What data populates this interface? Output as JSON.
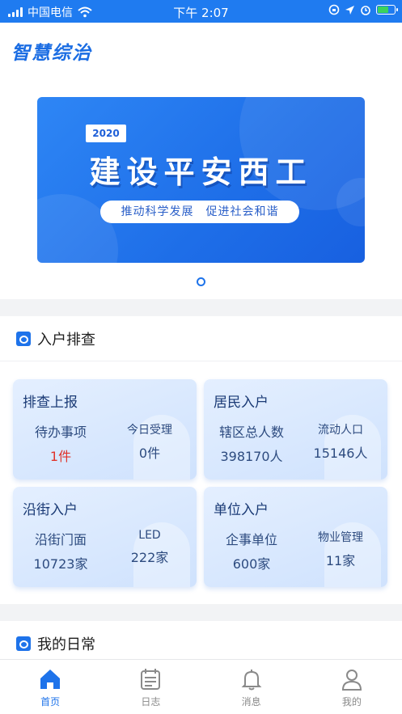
{
  "status_bar": {
    "carrier": "中国电信",
    "time": "下午 2:07"
  },
  "app": {
    "title": "智慧综治"
  },
  "banner": {
    "year": "2020",
    "headline": "建设平安西工",
    "slogan": "推动科学发展　促进社会和谐",
    "page_indicator": {
      "current": 1,
      "total": 1
    }
  },
  "household_section": {
    "title": "入户排查",
    "cards": [
      {
        "title": "排查上报",
        "items": [
          {
            "label": "待办事项",
            "value": "1件",
            "highlight": true
          },
          {
            "label": "今日受理",
            "value": "0件"
          }
        ]
      },
      {
        "title": "居民入户",
        "items": [
          {
            "label": "辖区总人数",
            "value": "398170人"
          },
          {
            "label": "流动人口",
            "value": "15146人"
          }
        ]
      },
      {
        "title": "沿街入户",
        "items": [
          {
            "label": "沿街门面",
            "value": "10723家"
          },
          {
            "label": "LED",
            "value": "222家"
          }
        ]
      },
      {
        "title": "单位入户",
        "items": [
          {
            "label": "企事单位",
            "value": "600家"
          },
          {
            "label": "物业管理",
            "value": "11家"
          }
        ]
      }
    ]
  },
  "daily_section": {
    "title": "我的日常"
  },
  "tabbar": {
    "items": [
      {
        "label": "首页",
        "icon": "home-icon",
        "active": true
      },
      {
        "label": "日志",
        "icon": "calendar-icon",
        "active": false
      },
      {
        "label": "消息",
        "icon": "bell-icon",
        "active": false
      },
      {
        "label": "我的",
        "icon": "user-icon",
        "active": false
      }
    ]
  },
  "colors": {
    "primary": "#1e73ea",
    "highlight": "#e0332a",
    "card_bg": "#dceaff"
  }
}
